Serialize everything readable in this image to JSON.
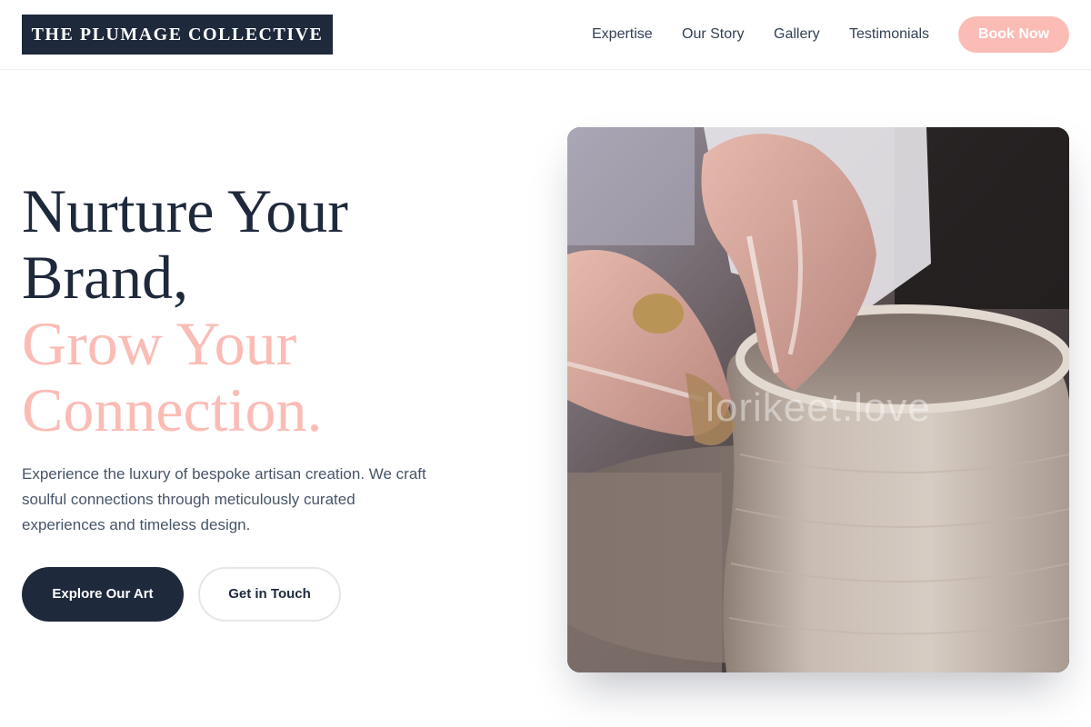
{
  "brand": {
    "logo_text": "THE PLUMAGE COLLECTIVE"
  },
  "nav": {
    "items": [
      {
        "label": "Expertise"
      },
      {
        "label": "Our Story"
      },
      {
        "label": "Gallery"
      },
      {
        "label": "Testimonials"
      }
    ],
    "cta_label": "Book Now"
  },
  "hero": {
    "headline_lines": [
      "Nurture Your",
      "Brand,",
      "Grow Your",
      "Connection."
    ],
    "lede": "Experience the luxury of bespoke artisan creation. We craft soulful connections through meticulously curated experiences and timeless design.",
    "primary_button": "Explore Our Art",
    "secondary_button": "Get in Touch",
    "image": {
      "subject": "hands-shaping-clay-pot-on-pottery-wheel",
      "watermark": "lorikeet.love"
    }
  },
  "colors": {
    "navy": "#1e293b",
    "blush": "#fbbcb6",
    "body_text": "#475569",
    "nav_text": "#334155"
  }
}
